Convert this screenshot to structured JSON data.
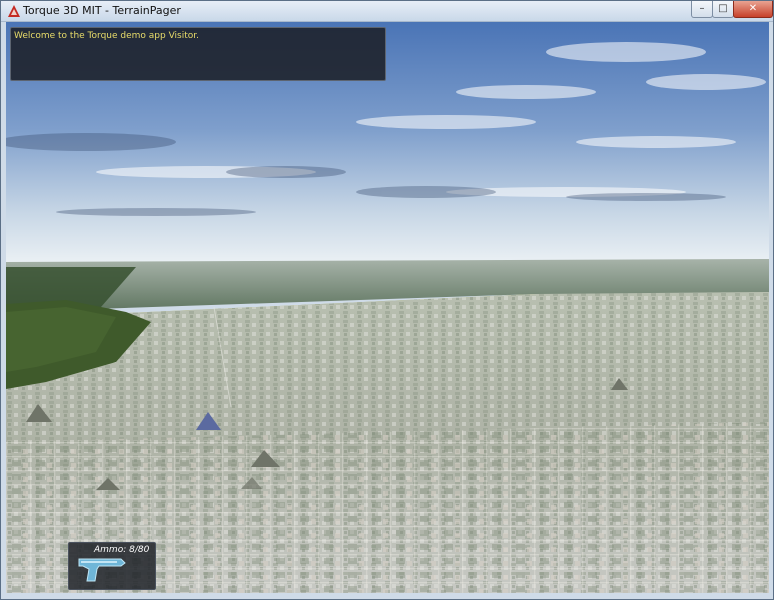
{
  "window": {
    "title": "Torque 3D MIT - TerrainPager",
    "controls": {
      "minimize": "–",
      "maximize": "□",
      "close": "✕"
    }
  },
  "hud": {
    "chat_message": "Welcome to the Torque demo app Visitor.",
    "ammo_label": "Ammo: 8/80",
    "weapon_icon": "pistol-icon"
  },
  "colors": {
    "chat_text": "#e8dc6a",
    "sky_top": "#4b76b6",
    "sky_horizon": "#e7eef4",
    "field": "#c7c866",
    "forest": "#3e5a36"
  }
}
